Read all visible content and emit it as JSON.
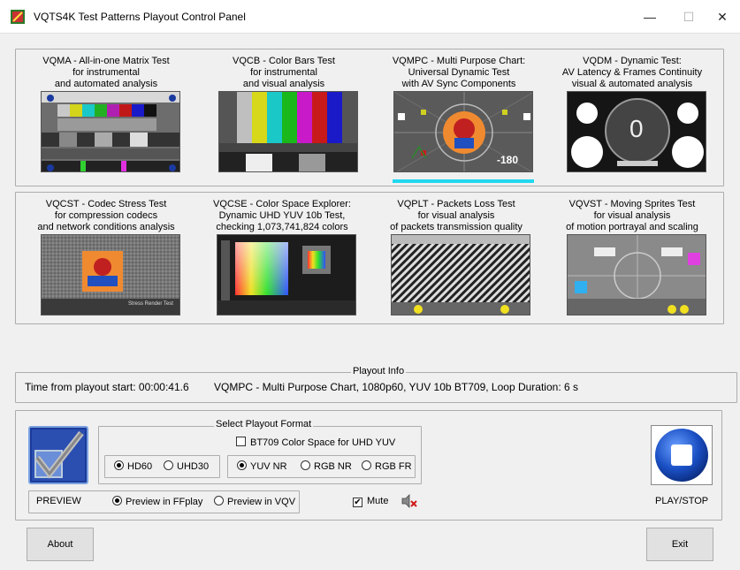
{
  "window": {
    "title": "VQTS4K Test Patterns Playout Control Panel",
    "min_glyph": "—",
    "max_glyph": "☐",
    "close_glyph": "✕"
  },
  "patterns": [
    {
      "caption": "VQMA - All-in-one Matrix Test\nfor instrumental\nand automated analysis"
    },
    {
      "caption": "VQCB - Color Bars Test\nfor instrumental\nand visual analysis"
    },
    {
      "caption": "VQMPC - Multi Purpose Chart:\nUniversal Dynamic Test\nwith AV Sync Components"
    },
    {
      "caption": "VQDM - Dynamic Test:\nAV Latency & Frames Continuity\nvisual & automated analysis"
    },
    {
      "caption": "VQCST - Codec Stress Test\nfor compression codecs\nand network conditions analysis"
    },
    {
      "caption": "VQCSE - Color Space Explorer:\nDynamic UHD YUV 10b Test,\nchecking 1,073,741,824 colors"
    },
    {
      "caption": "VQPLT - Packets Loss Test\nfor visual analysis\nof packets transmission quality"
    },
    {
      "caption": "VQVST - Moving Sprites Test\nfor visual analysis\nof motion portrayal and scaling"
    }
  ],
  "thumb_text": {
    "mpc_counter": "-180",
    "dm_counter": "0",
    "cst_label": "Stress Render Test"
  },
  "playout_info": {
    "legend": "Playout Info",
    "time_label": "Time from playout start: 00:00:41.6",
    "details": "VQMPC - Multi Purpose Chart, 1080p60, YUV 10b  BT709, Loop Duration: 6 s"
  },
  "format": {
    "legend": "Select Playout Format",
    "bt709_label": "BT709 Color Space for UHD YUV",
    "bt709_checked": false,
    "resolution_options": [
      "HD60",
      "UHD30"
    ],
    "resolution_selected": "HD60",
    "color_options": [
      "YUV NR",
      "RGB NR",
      "RGB FR"
    ],
    "color_selected": "YUV NR"
  },
  "preview": {
    "label": "PREVIEW",
    "options": [
      "Preview in FFplay",
      "Preview in VQV"
    ],
    "selected": "Preview in FFplay"
  },
  "mute": {
    "label": "Mute",
    "checked": true,
    "check_glyph": "✔"
  },
  "play_stop_label": "PLAY/STOP",
  "about_label": "About",
  "exit_label": "Exit",
  "colors": {
    "selection_bar": "#20d8f0",
    "play_button": "#1a4fc4"
  }
}
